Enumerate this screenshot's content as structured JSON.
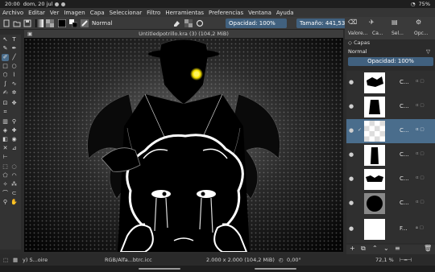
{
  "system": {
    "time": "20:00",
    "date": "dom, 20 jul",
    "battery": "75%"
  },
  "menu": [
    "Archivo",
    "Editar",
    "Ver",
    "Imagen",
    "Capa",
    "Seleccionar",
    "Filtro",
    "Herramientas",
    "Preferencias",
    "Ventana",
    "Ayuda"
  ],
  "tool_options": {
    "blend_mode": "Normal",
    "opacity": "Opacidad: 100%",
    "size": "Tamaño: 441,53 px"
  },
  "document": {
    "tab_title": "Untitledpotrillo.kra (3) (104,2 MiB)"
  },
  "panel": {
    "tabs": [
      "Valore...",
      "Ca...",
      "Sel...",
      "Opc..."
    ],
    "layers_title": "Capas",
    "blend_mode": "Normal",
    "opacity": "Opacidad: 100%",
    "layers": [
      {
        "name": "C...",
        "selected": false
      },
      {
        "name": "C...",
        "selected": false
      },
      {
        "name": "C...",
        "selected": true
      },
      {
        "name": "C...",
        "selected": false
      },
      {
        "name": "C...",
        "selected": false
      },
      {
        "name": "C...",
        "selected": false
      },
      {
        "name": "F...",
        "selected": false
      }
    ]
  },
  "status": {
    "brush": "y) S...oire",
    "color_space": "RGB/Alfa...btrc.icc",
    "dimensions": "2.000 x 2.000 (104,2 MiB)",
    "rotation": "0,00°",
    "zoom": "72,1 %"
  },
  "colors": {
    "accent": "#41617f",
    "selection": "#4a6d8c",
    "eye_glow": "#f5e000"
  }
}
